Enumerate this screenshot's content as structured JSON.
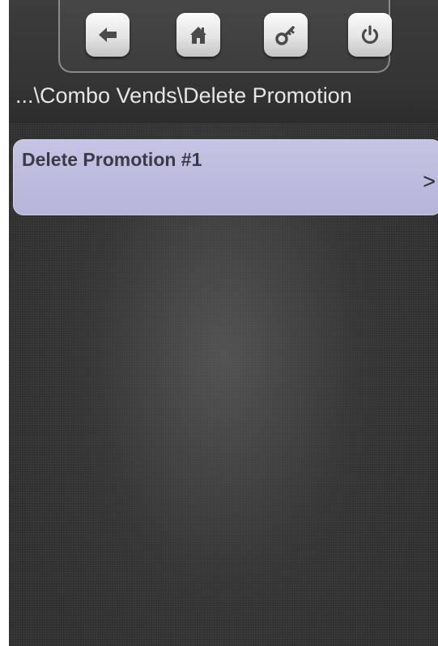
{
  "toolbar": {
    "buttons": [
      {
        "name": "back",
        "icon": "arrow-left-icon"
      },
      {
        "name": "home",
        "icon": "house-icon"
      },
      {
        "name": "service-key",
        "icon": "key-icon"
      },
      {
        "name": "power",
        "icon": "power-icon"
      }
    ]
  },
  "breadcrumb": {
    "text": "...\\Combo Vends\\Delete Promotion"
  },
  "menu": {
    "items": [
      {
        "label": "Delete Promotion #1",
        "arrow": ">"
      }
    ]
  },
  "colors": {
    "background": "#2e2e2e",
    "header_band": "#3a3a3a",
    "menu_item_fill": "#bdbbde",
    "menu_item_text": "#3a3a4a",
    "icon_dark": "#4a4a4a"
  }
}
